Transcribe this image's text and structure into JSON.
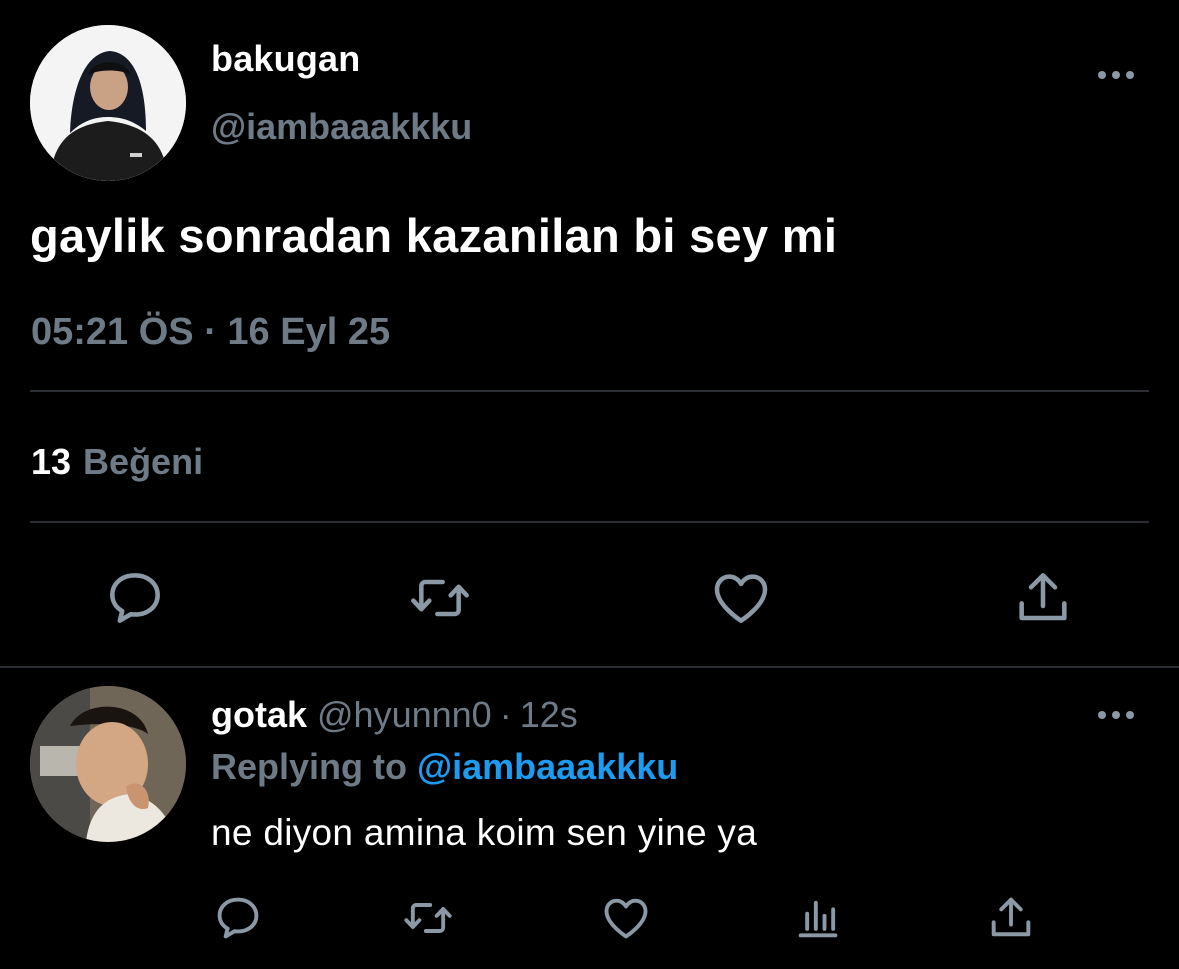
{
  "main_tweet": {
    "display_name": "bakugan",
    "handle": "@iambaaakkku",
    "text": "gaylik sonradan kazanilan bi sey mi",
    "timestamp": "05:21 ÖS · 16 Eyl 25",
    "likes_count": "13",
    "likes_label": "Beğeni",
    "actions": [
      "reply-icon",
      "retweet-icon",
      "heart-icon",
      "share-icon"
    ]
  },
  "reply_tweet": {
    "display_name": "gotak",
    "handle": "@hyunnn0",
    "separator": "·",
    "time_ago": "12s",
    "replying_label": "Replying to",
    "replying_mention": "@iambaaakkku",
    "text": "ne diyon amina koim sen yine ya",
    "actions": [
      "reply-icon",
      "retweet-icon",
      "heart-icon",
      "stats-icon",
      "share-icon"
    ]
  },
  "colors": {
    "background": "#000000",
    "primary_text": "#ffffff",
    "secondary_text": "#6e7b87",
    "mention": "#1d9bf0",
    "divider": "#2a2d31",
    "icon": "#8b98a5"
  }
}
